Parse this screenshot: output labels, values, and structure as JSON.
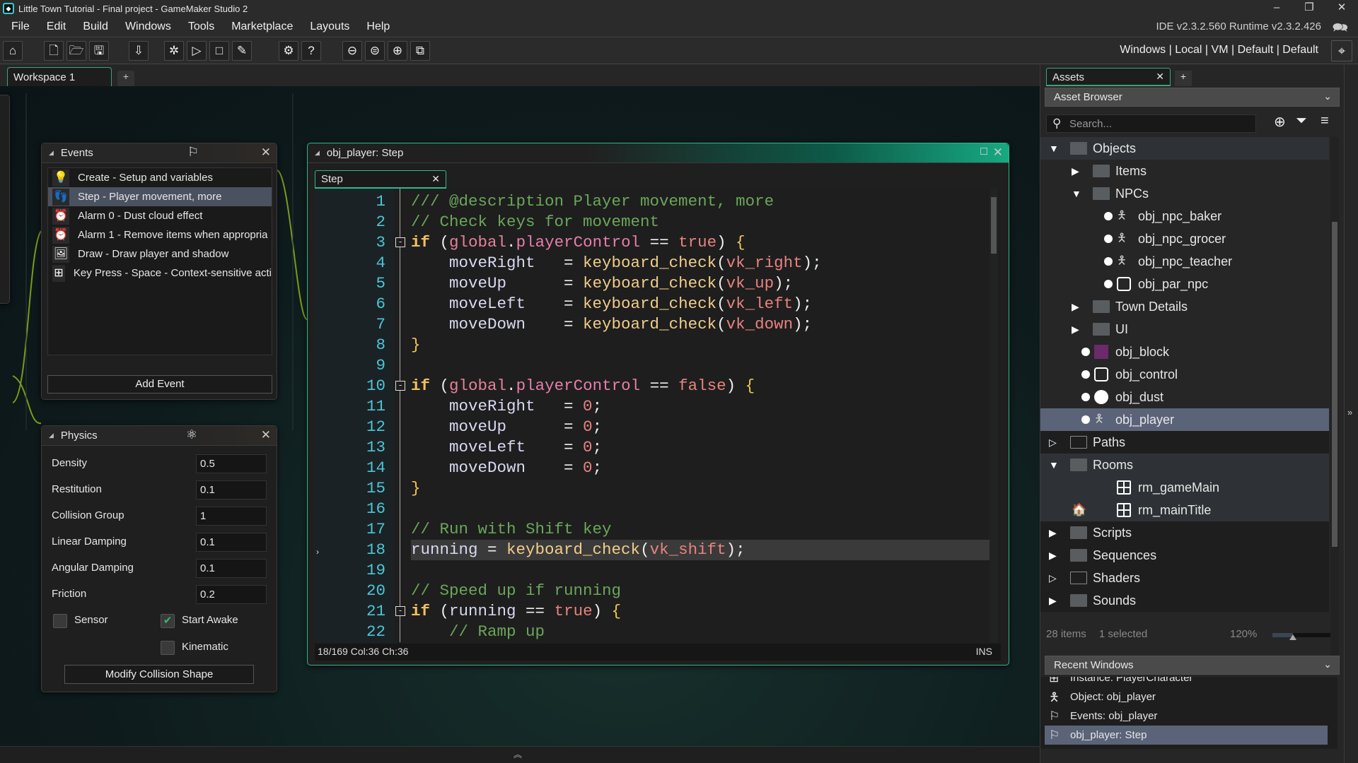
{
  "window": {
    "title": "Little Town Tutorial - Final project - GameMaker Studio 2",
    "minimize": "–",
    "restore": "❐",
    "close": "✕"
  },
  "menu": [
    "File",
    "Edit",
    "Build",
    "Windows",
    "Tools",
    "Marketplace",
    "Layouts",
    "Help"
  ],
  "version": "IDE v2.3.2.560  Runtime v2.3.2.426",
  "toolbar": {
    "buttons": [
      {
        "name": "home-icon",
        "glyph": "⌂"
      },
      {
        "name": "new-project-icon",
        "glyph": "🗋"
      },
      {
        "name": "open-project-icon",
        "glyph": "🗁"
      },
      {
        "name": "save-icon",
        "glyph": "🖫"
      },
      {
        "name": "create-executable-icon",
        "glyph": "⇩"
      },
      {
        "name": "debug-icon",
        "glyph": "✲"
      },
      {
        "name": "run-icon",
        "glyph": "▷"
      },
      {
        "name": "stop-icon",
        "glyph": "□"
      },
      {
        "name": "clean-icon",
        "glyph": "✎"
      },
      {
        "name": "game-options-icon",
        "glyph": "⚙"
      },
      {
        "name": "help-icon",
        "glyph": "?"
      },
      {
        "name": "zoom-out-icon",
        "glyph": "⊖"
      },
      {
        "name": "zoom-reset-icon",
        "glyph": "⊜"
      },
      {
        "name": "zoom-in-icon",
        "glyph": "⊕"
      },
      {
        "name": "fit-view-icon",
        "glyph": "⧉"
      }
    ],
    "target": "Windows | Local | VM | Default | Default"
  },
  "workspace": {
    "tab": "Workspace 1",
    "add": "+"
  },
  "events_panel": {
    "title": "Events",
    "items": [
      {
        "label": "Create - Setup and variables",
        "icon": "lightbulb-icon",
        "glyph": "💡"
      },
      {
        "label": "Step - Player movement, more",
        "icon": "footsteps-icon",
        "glyph": "👣",
        "selected": true
      },
      {
        "label": "Alarm 0 - Dust cloud effect",
        "icon": "alarm-clock-icon",
        "glyph": "⏰"
      },
      {
        "label": "Alarm 1 - Remove items when appropria",
        "icon": "alarm-clock-icon",
        "glyph": "⏰"
      },
      {
        "label": "Draw - Draw player and shadow",
        "icon": "picture-icon",
        "glyph": "🖼"
      },
      {
        "label": "Key Press - Space - Context-sensitive acti",
        "icon": "keypress-icon",
        "glyph": "⊞"
      }
    ],
    "add_event": "Add Event"
  },
  "physics_panel": {
    "title": "Physics",
    "fields": [
      {
        "label": "Density",
        "value": "0.5"
      },
      {
        "label": "Restitution",
        "value": "0.1"
      },
      {
        "label": "Collision Group",
        "value": "1"
      },
      {
        "label": "Linear Damping",
        "value": "0.1"
      },
      {
        "label": "Angular Damping",
        "value": "0.1"
      },
      {
        "label": "Friction",
        "value": "0.2"
      }
    ],
    "sensor": {
      "label": "Sensor",
      "checked": false
    },
    "start_awake": {
      "label": "Start Awake",
      "checked": true
    },
    "kinematic": {
      "label": "Kinematic",
      "checked": false
    },
    "modify_shape": "Modify Collision Shape"
  },
  "code_editor": {
    "title": "obj_player: Step",
    "tab": "Step",
    "current_line": 18,
    "lines": [
      [
        [
          "comment",
          "/// @description Player movement, more"
        ]
      ],
      [
        [
          "comment",
          "// Check keys for movement"
        ]
      ],
      [
        [
          "kw",
          "if"
        ],
        [
          "op",
          " ("
        ],
        [
          "global",
          "global"
        ],
        [
          "op",
          "."
        ],
        [
          "prop",
          "playerControl"
        ],
        [
          "op",
          " == "
        ],
        [
          "const",
          "true"
        ],
        [
          "op",
          ") "
        ],
        [
          "brace",
          "{"
        ]
      ],
      [
        [
          "var",
          "    moveRight"
        ],
        [
          "op",
          "   = "
        ],
        [
          "fn",
          "keyboard_check"
        ],
        [
          "op",
          "("
        ],
        [
          "const",
          "vk_right"
        ],
        [
          "op",
          ");"
        ]
      ],
      [
        [
          "var",
          "    moveUp"
        ],
        [
          "op",
          "      = "
        ],
        [
          "fn",
          "keyboard_check"
        ],
        [
          "op",
          "("
        ],
        [
          "const",
          "vk_up"
        ],
        [
          "op",
          ");"
        ]
      ],
      [
        [
          "var",
          "    moveLeft"
        ],
        [
          "op",
          "    = "
        ],
        [
          "fn",
          "keyboard_check"
        ],
        [
          "op",
          "("
        ],
        [
          "const",
          "vk_left"
        ],
        [
          "op",
          ");"
        ]
      ],
      [
        [
          "var",
          "    moveDown"
        ],
        [
          "op",
          "    = "
        ],
        [
          "fn",
          "keyboard_check"
        ],
        [
          "op",
          "("
        ],
        [
          "const",
          "vk_down"
        ],
        [
          "op",
          ");"
        ]
      ],
      [
        [
          "brace",
          "}"
        ]
      ],
      [],
      [
        [
          "kw",
          "if"
        ],
        [
          "op",
          " ("
        ],
        [
          "global",
          "global"
        ],
        [
          "op",
          "."
        ],
        [
          "prop",
          "playerControl"
        ],
        [
          "op",
          " == "
        ],
        [
          "const",
          "false"
        ],
        [
          "op",
          ") "
        ],
        [
          "brace",
          "{"
        ]
      ],
      [
        [
          "var",
          "    moveRight"
        ],
        [
          "op",
          "   = "
        ],
        [
          "num",
          "0"
        ],
        [
          "op",
          ";"
        ]
      ],
      [
        [
          "var",
          "    moveUp"
        ],
        [
          "op",
          "      = "
        ],
        [
          "num",
          "0"
        ],
        [
          "op",
          ";"
        ]
      ],
      [
        [
          "var",
          "    moveLeft"
        ],
        [
          "op",
          "    = "
        ],
        [
          "num",
          "0"
        ],
        [
          "op",
          ";"
        ]
      ],
      [
        [
          "var",
          "    moveDown"
        ],
        [
          "op",
          "    = "
        ],
        [
          "num",
          "0"
        ],
        [
          "op",
          ";"
        ]
      ],
      [
        [
          "brace",
          "}"
        ]
      ],
      [],
      [
        [
          "comment",
          "// Run with Shift key"
        ]
      ],
      [
        [
          "var",
          "running"
        ],
        [
          "op",
          " = "
        ],
        [
          "fn",
          "keyboard_check"
        ],
        [
          "op",
          "("
        ],
        [
          "const",
          "vk_shift"
        ],
        [
          "op",
          ");"
        ]
      ],
      [],
      [
        [
          "comment",
          "// Speed up if running"
        ]
      ],
      [
        [
          "kw",
          "if"
        ],
        [
          "op",
          " ("
        ],
        [
          "var",
          "running"
        ],
        [
          "op",
          " == "
        ],
        [
          "const",
          "true"
        ],
        [
          "op",
          ") "
        ],
        [
          "brace",
          "{"
        ]
      ],
      [
        [
          "comment",
          "    // Ramp up"
        ]
      ]
    ],
    "folds": [
      3,
      10,
      21
    ],
    "status": "18/169 Col:36 Ch:36",
    "mode": "INS"
  },
  "assets": {
    "tab": "Assets",
    "browser": "Asset Browser",
    "search_placeholder": "Search...",
    "tree": [
      {
        "label": "Objects",
        "level": 0,
        "kind": "folder",
        "expanded": true,
        "style": "open"
      },
      {
        "label": "Items",
        "level": 1,
        "kind": "folder",
        "expanded": false
      },
      {
        "label": "NPCs",
        "level": 1,
        "kind": "folder",
        "expanded": true
      },
      {
        "label": "obj_npc_baker",
        "level": 2,
        "kind": "object",
        "icon": "npc-baker-sprite-icon"
      },
      {
        "label": "obj_npc_grocer",
        "level": 2,
        "kind": "object",
        "icon": "npc-grocer-sprite-icon"
      },
      {
        "label": "obj_npc_teacher",
        "level": 2,
        "kind": "object",
        "icon": "npc-teacher-sprite-icon"
      },
      {
        "label": "obj_par_npc",
        "level": 2,
        "kind": "object",
        "icon": "no-sprite-icon"
      },
      {
        "label": "Town Details",
        "level": 1,
        "kind": "folder",
        "expanded": false
      },
      {
        "label": "UI",
        "level": 1,
        "kind": "folder",
        "expanded": false
      },
      {
        "label": "obj_block",
        "level": 1,
        "kind": "object",
        "icon": "block-sprite-icon",
        "color": "#6b2a6b"
      },
      {
        "label": "obj_control",
        "level": 1,
        "kind": "object",
        "icon": "no-sprite-icon"
      },
      {
        "label": "obj_dust",
        "level": 1,
        "kind": "object",
        "icon": "dust-sprite-icon"
      },
      {
        "label": "obj_player",
        "level": 1,
        "kind": "object",
        "icon": "player-sprite-icon",
        "selected": true
      },
      {
        "label": "Paths",
        "level": 0,
        "kind": "folder",
        "expanded": false,
        "empty": true,
        "style": "dark"
      },
      {
        "label": "Rooms",
        "level": 0,
        "kind": "folder",
        "expanded": true,
        "style": "open"
      },
      {
        "label": "rm_gameMain",
        "level": 1,
        "kind": "room",
        "style": "open"
      },
      {
        "label": "rm_mainTitle",
        "level": 1,
        "kind": "room",
        "home": true,
        "style": "open"
      },
      {
        "label": "Scripts",
        "level": 0,
        "kind": "folder",
        "expanded": false,
        "style": "dark"
      },
      {
        "label": "Sequences",
        "level": 0,
        "kind": "folder",
        "expanded": false,
        "style": "dark"
      },
      {
        "label": "Shaders",
        "level": 0,
        "kind": "folder",
        "expanded": false,
        "empty": true,
        "style": "dark"
      },
      {
        "label": "Sounds",
        "level": 0,
        "kind": "folder",
        "expanded": false,
        "style": "dark"
      }
    ],
    "count": "28 items",
    "selected": "1 selected",
    "zoom": "120%",
    "zoom_level": 0.35
  },
  "recent": {
    "title": "Recent Windows",
    "items": [
      {
        "label": "Instance: PlayerCharacter",
        "icon": "room-icon",
        "glyph": "⊞"
      },
      {
        "label": "Object: obj_player",
        "icon": "player-sprite-icon",
        "glyph": "🯅"
      },
      {
        "label": "Events: obj_player",
        "icon": "flag-icon",
        "glyph": "⚐"
      },
      {
        "label": "obj_player: Step",
        "icon": "flag-icon",
        "glyph": "⚐",
        "selected": true
      }
    ]
  },
  "colors": {
    "accent": "#2fb98a",
    "selection": "#5a6378",
    "line_number": "#4cc6d6",
    "comment": "#6aa75a"
  }
}
